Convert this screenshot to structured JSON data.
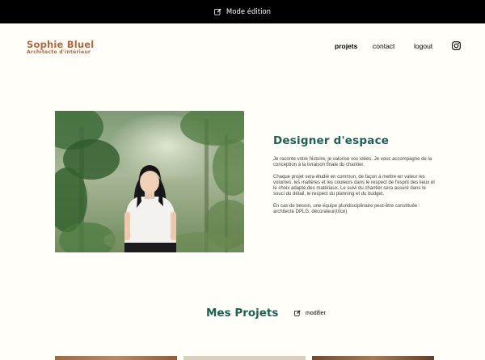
{
  "edit_bar": {
    "label": "Mode édition",
    "icon": "edit-icon"
  },
  "brand": {
    "name": "Sophie Bluel",
    "subtitle": "Architecte d'intérieur",
    "color": "#b1663c"
  },
  "nav": {
    "items": [
      "projets",
      "contact",
      "logout"
    ],
    "active": "projets",
    "social_icon": "instagram-icon"
  },
  "intro": {
    "title": "Designer d'espace",
    "paragraphs": [
      "Je raconte votre histoire, je valorise vos idées. Je vous accompagne de la conception à la livraison finale du chantier.",
      "Chaque projet sera étudié en commun, de façon à mettre en valeur les volumes, les matières et les couleurs dans le respect de l'esprit des lieux et le choix adapté des matériaux. Le suivi du chantier sera assuré dans le souci du détail, le respect du planning et du budget.",
      "En cas de besoin, une équipe pluridisciplinaire peut-être constituée : architecte DPLG, décorateur(trice)"
    ]
  },
  "projects": {
    "title": "Mes Projets",
    "modify_label": "modifier",
    "modify_icon": "edit-icon"
  },
  "colors": {
    "primary": "#1d6154",
    "accent": "#b1663c",
    "background": "#fffef8",
    "edit_bar": "#000000"
  }
}
